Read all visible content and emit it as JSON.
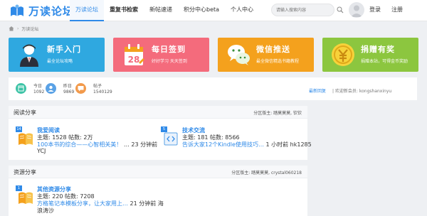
{
  "brand": {
    "name": "万读论坛"
  },
  "nav": {
    "items": [
      {
        "label": "万读论坛",
        "active": true,
        "bold": false
      },
      {
        "label": "重复书检索",
        "active": false,
        "bold": true
      },
      {
        "label": "新帖速递",
        "active": false,
        "bold": false
      },
      {
        "label": "积分中心beta",
        "active": false,
        "bold": false
      },
      {
        "label": "个人中心",
        "active": false,
        "bold": false
      }
    ]
  },
  "search": {
    "placeholder": "请输入搜索内容"
  },
  "auth": {
    "login": "登录",
    "register": "注册"
  },
  "breadcrumb": {
    "home_icon": "home-icon",
    "current": "万读论坛"
  },
  "banners": [
    {
      "title": "新手入门",
      "subtitle": "最全论坛攻略",
      "color": "#2fa8e0",
      "icon": "person-icon"
    },
    {
      "title": "每日签到",
      "subtitle": "好好学习 天天签到",
      "color": "#f46b7c",
      "icon": "calendar-icon"
    },
    {
      "title": "微信推送",
      "subtitle": "最全微信精选书籍教程",
      "color": "#f4a11d",
      "icon": "wechat-icon"
    },
    {
      "title": "捐赠有奖",
      "subtitle": "捐赠本站，可得金币奖励",
      "color": "#8cc63f",
      "icon": "coin-icon"
    }
  ],
  "stats": {
    "today": {
      "label": "今日",
      "value": "1092"
    },
    "yesterday": {
      "label": "昨日",
      "value": "9869"
    },
    "posts": {
      "label": "帖子",
      "value": "1540129"
    },
    "newest_link": "最新回复",
    "welcome": "| 欢迎新会员: kongshanxinyu"
  },
  "sections": [
    {
      "title": "阅读分享",
      "moderators": "分区版主: 踏莫莫莫, 钦钦",
      "forums": [
        {
          "badge": "14",
          "name": "我爱阅读",
          "stats": "主题: 1528 帖数: 2万",
          "latest_link": "100本书的综合——心智相关美！",
          "latest_meta": "… 23 分钟前",
          "user": "YCJ"
        },
        {
          "badge": "5",
          "name": "技术交流",
          "stats": "主题: 181 帖数: 8566",
          "latest_link": "告诉大家12个Kindle使用技巧…",
          "latest_meta": "1 小时前 hk1285",
          "user": ""
        }
      ]
    },
    {
      "title": "资源分享",
      "moderators": "分区版主: 踏莫莫莫, crystal060218",
      "forums": [
        {
          "badge": "1",
          "name": "其他资源分享",
          "stats": "主题: 220 帖数: 7208",
          "latest_link": "方格笔记本模板分享，让大家用上…",
          "latest_meta": "21 分钟前 海",
          "user": "浪涛沙"
        }
      ]
    }
  ]
}
